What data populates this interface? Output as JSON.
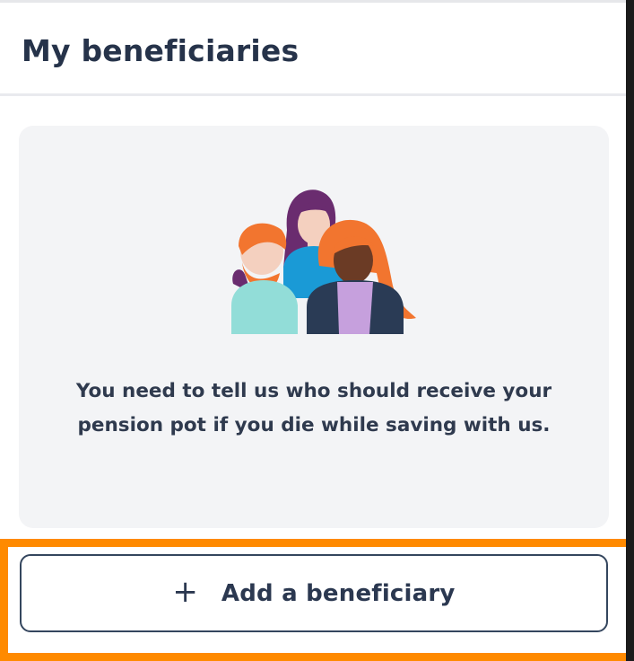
{
  "card": {
    "title": "My beneficiaries"
  },
  "empty_state": {
    "illustration": "group-of-people-icon",
    "message": "You need to tell us who should receive your pension pot if you die while saving with us."
  },
  "add_button": {
    "icon": "plus-icon",
    "icon_glyph": "+",
    "label": "Add a beneficiary"
  },
  "colors": {
    "title_text": "#26334a",
    "panel_background": "#f3f4f6",
    "button_border": "#34465e",
    "highlight_outline": "#ff8a00"
  }
}
